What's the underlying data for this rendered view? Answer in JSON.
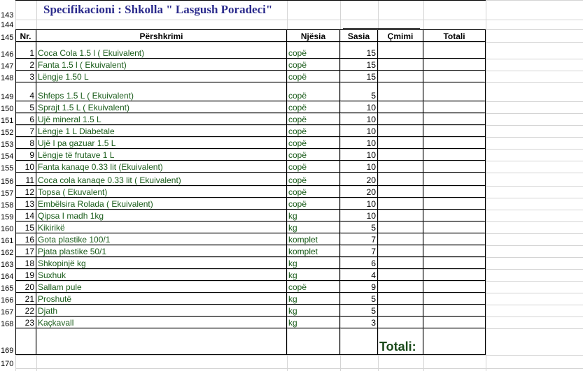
{
  "title": "Specifikacioni : Shkolla \" Lasgush Poradeci\"",
  "row_numbers": [
    "143",
    "144",
    "145",
    "146",
    "147",
    "148",
    "149",
    "150",
    "151",
    "152",
    "153",
    "154",
    "155",
    "156",
    "157",
    "158",
    "159",
    "160",
    "161",
    "162",
    "163",
    "164",
    "165",
    "166",
    "167",
    "168",
    "169",
    "170"
  ],
  "headers": {
    "nr": "Nr.",
    "pershkrimi": "Përshkrimi",
    "njesia": "Njësia",
    "sasia": "Sasia",
    "cmimi": "Çmimi",
    "totali": "Totali"
  },
  "items": [
    {
      "nr": "1",
      "desc": "Coca Cola 1.5 l ( Ekuivalent)",
      "unit": "copë",
      "qty": "15"
    },
    {
      "nr": "2",
      "desc": "Fanta 1.5 l ( Ekuivalent)",
      "unit": "copë",
      "qty": "15"
    },
    {
      "nr": "3",
      "desc": "Lëngje 1.50 L",
      "unit": "copë",
      "qty": "15"
    },
    {
      "nr": "4",
      "desc": "Shfeps 1.5 L ( Ekuivalent)",
      "unit": "copë",
      "qty": "5"
    },
    {
      "nr": "5",
      "desc": "Sprajt 1.5 L ( Ekuivalent)",
      "unit": "copë",
      "qty": "10"
    },
    {
      "nr": "6",
      "desc": "Ujë mineral 1.5 L",
      "unit": "copë",
      "qty": "10"
    },
    {
      "nr": "7",
      "desc": "Lëngje 1 L Diabetale",
      "unit": "copë",
      "qty": "10"
    },
    {
      "nr": "8",
      "desc": "Ujë I pa gazuar 1.5 L",
      "unit": "copë",
      "qty": "10"
    },
    {
      "nr": "9",
      "desc": "Lëngje të frutave 1 L",
      "unit": "copë",
      "qty": "10"
    },
    {
      "nr": "10",
      "desc": "Fanta kanaqe 0.33 lit (Ekuivalent)",
      "unit": "copë",
      "qty": "10"
    },
    {
      "nr": "11",
      "desc": "Coca cola kanaqe 0.33 lit ( Ekuivalent)",
      "unit": "copë",
      "qty": "20"
    },
    {
      "nr": "12",
      "desc": "Topsa ( Ekuvalent)",
      "unit": "copë",
      "qty": "20"
    },
    {
      "nr": "13",
      "desc": "Embëlsira Rolada ( Ekuivalent)",
      "unit": "copë",
      "qty": "10"
    },
    {
      "nr": "14",
      "desc": "Qipsa I madh 1kg",
      "unit": "kg",
      "qty": "10"
    },
    {
      "nr": "15",
      "desc": "Kikirikë",
      "unit": "kg",
      "qty": "5"
    },
    {
      "nr": "16",
      "desc": "Gota plastike 100/1",
      "unit": "komplet",
      "qty": "7"
    },
    {
      "nr": "17",
      "desc": "Pjata plastike 50/1",
      "unit": "komplet",
      "qty": "7"
    },
    {
      "nr": "18",
      "desc": "Shkopinjë kg",
      "unit": "kg",
      "qty": "6"
    },
    {
      "nr": "19",
      "desc": "Suxhuk",
      "unit": "kg",
      "qty": "4"
    },
    {
      "nr": "20",
      "desc": "Sallam pule",
      "unit": "copë",
      "qty": "9"
    },
    {
      "nr": "21",
      "desc": "Proshutë",
      "unit": "kg",
      "qty": "5"
    },
    {
      "nr": "22",
      "desc": "Djath",
      "unit": "kg",
      "qty": "5"
    },
    {
      "nr": "23",
      "desc": "Kaçkavall",
      "unit": "kg",
      "qty": "3"
    }
  ],
  "totals_label": "Totali:"
}
